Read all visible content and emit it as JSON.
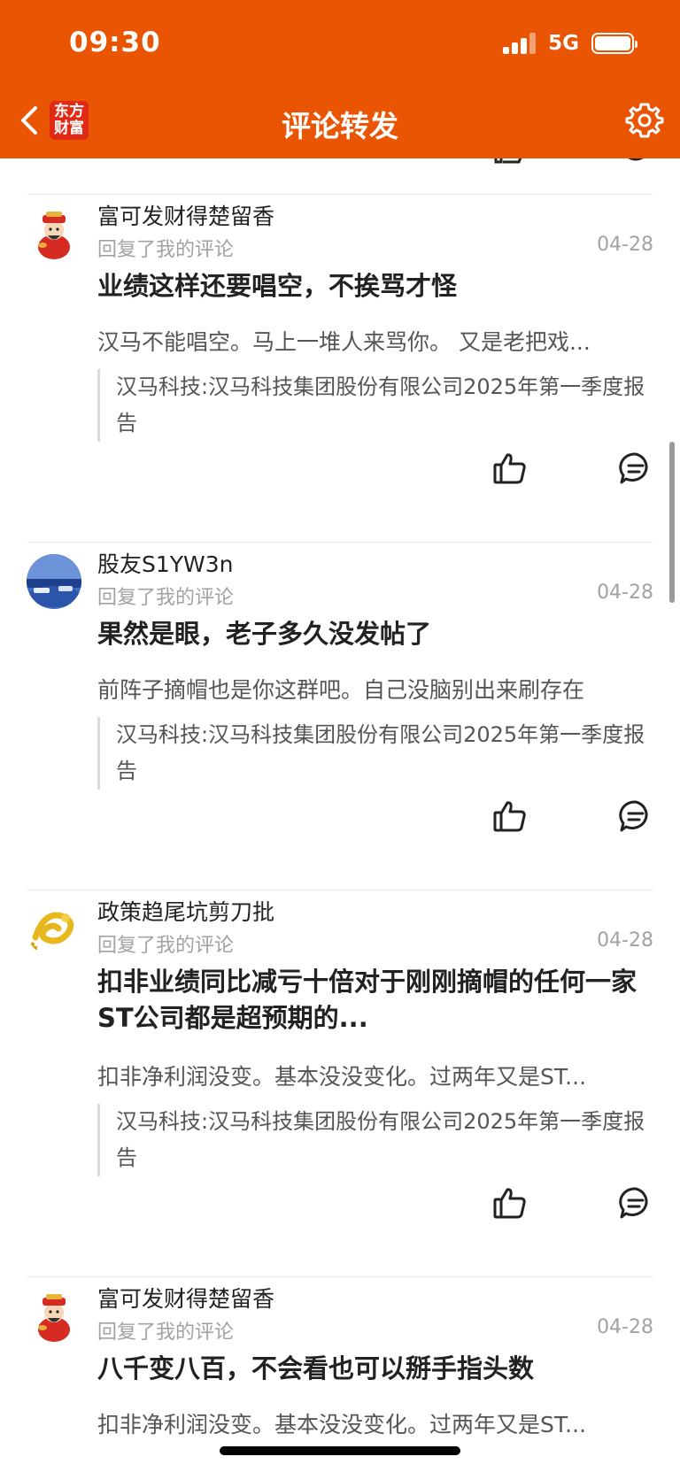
{
  "status": {
    "time": "09:30",
    "network": "5G"
  },
  "header": {
    "title": "评论转发",
    "logo_line1": "东方",
    "logo_line2": "财富"
  },
  "comments": [
    {
      "username": "富可发财得楚留香",
      "reply_tag": "回复了我的评论",
      "date": "04-28",
      "title": "业绩这样还要唱空，不挨骂才怪",
      "excerpt": "汉马不能唱空。马上一堆人来骂你。 又是老把戏...",
      "quote": "汉马科技:汉马科技集团股份有限公司2025年第一季度报告",
      "avatar": "caishen"
    },
    {
      "username": "股友S1YW3n",
      "reply_tag": "回复了我的评论",
      "date": "04-28",
      "title": "果然是眼，老子多久没发帖了",
      "excerpt": "前阵子摘帽也是你这群吧。自己没脑别出来刷存在",
      "quote": "汉马科技:汉马科技集团股份有限公司2025年第一季度报告",
      "avatar": "landscape"
    },
    {
      "username": "政策趋尾坑剪刀批",
      "reply_tag": "回复了我的评论",
      "date": "04-28",
      "title": "扣非业绩同比减亏十倍对于刚刚摘帽的任何一家ST公司都是超预期的...",
      "excerpt": "扣非净利润没变。基本没没变化。过两年又是ST...",
      "quote": "汉马科技:汉马科技集团股份有限公司2025年第一季度报告",
      "avatar": "golden-dragon"
    },
    {
      "username": "富可发财得楚留香",
      "reply_tag": "回复了我的评论",
      "date": "04-28",
      "title": "八千变八百，不会看也可以掰手指头数",
      "excerpt": "扣非净利润没变。基本没没变化。过两年又是ST...",
      "avatar": "caishen"
    }
  ],
  "icons": {
    "like": "thumbs-up-icon",
    "reply": "comment-bubble-icon",
    "back": "chevron-left-icon",
    "settings": "gear-icon"
  },
  "colors": {
    "brand": "#EA5504",
    "logo": "#E02A14"
  }
}
